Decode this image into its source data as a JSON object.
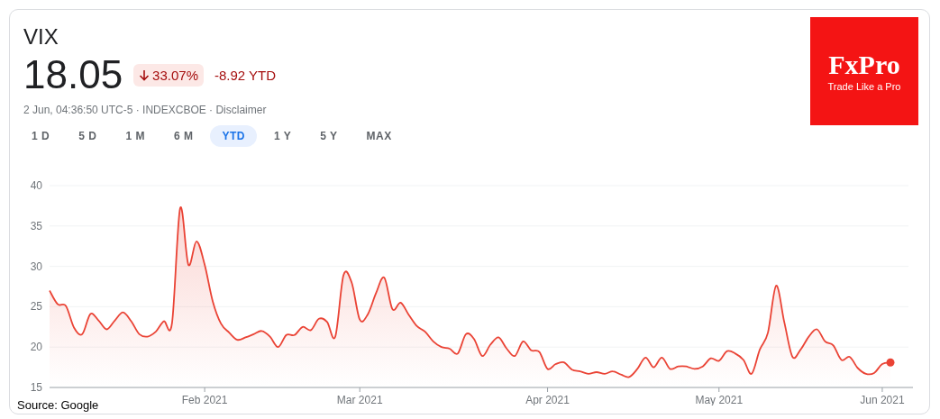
{
  "quote": {
    "ticker": "VIX",
    "price": "18.05",
    "change": {
      "negative": true,
      "text": "33.07%"
    },
    "ytd": "-8.92 YTD",
    "meta": "2 Jun, 04:36:50 UTC-5 · INDEXCBOE · Disclaimer"
  },
  "ranges": [
    {
      "label": "1 D",
      "selected": false
    },
    {
      "label": "5 D",
      "selected": false
    },
    {
      "label": "1 M",
      "selected": false
    },
    {
      "label": "6 M",
      "selected": false
    },
    {
      "label": "YTD",
      "selected": true
    },
    {
      "label": "1 Y",
      "selected": false
    },
    {
      "label": "5 Y",
      "selected": false
    },
    {
      "label": "MAX",
      "selected": false
    }
  ],
  "logo": {
    "name": "FxPro",
    "tagline": "Trade Like a Pro"
  },
  "chart_data": {
    "type": "area",
    "categories": [
      null,
      null,
      null,
      null,
      null,
      null,
      null,
      null,
      null,
      null,
      null,
      null,
      null,
      null,
      null,
      null,
      null,
      null,
      null,
      "Feb 2021",
      null,
      null,
      null,
      null,
      null,
      null,
      null,
      null,
      null,
      null,
      null,
      null,
      null,
      null,
      null,
      null,
      null,
      null,
      "Mar 2021",
      null,
      null,
      null,
      null,
      null,
      null,
      null,
      null,
      null,
      null,
      null,
      null,
      null,
      null,
      null,
      null,
      null,
      null,
      null,
      null,
      null,
      null,
      "Apr 2021",
      null,
      null,
      null,
      null,
      null,
      null,
      null,
      null,
      null,
      null,
      null,
      null,
      null,
      null,
      null,
      null,
      null,
      null,
      null,
      null,
      "May 2021",
      null,
      null,
      null,
      null,
      null,
      null,
      null,
      null,
      null,
      null,
      null,
      null,
      null,
      null,
      null,
      null,
      null,
      null,
      null,
      "Jun 2021",
      null
    ],
    "series": [
      {
        "color": "#ea4335",
        "values": [
          27,
          25.3,
          25.1,
          22.4,
          21.6,
          24.1,
          23.3,
          22.2,
          23.3,
          24.3,
          23.2,
          21.6,
          21.3,
          21.9,
          23.2,
          23,
          37.2,
          30.2,
          33.1,
          30.2,
          25.6,
          22.9,
          21.8,
          20.9,
          21.2,
          21.6,
          22,
          21.3,
          20,
          21.5,
          21.5,
          22.5,
          22.1,
          23.5,
          23.1,
          21.3,
          28.9,
          28,
          23.4,
          24.1,
          26.7,
          28.6,
          24.7,
          25.5,
          24,
          22.6,
          21.9,
          20.7,
          20,
          19.8,
          19.2,
          21.6,
          21,
          18.9,
          20.3,
          21.2,
          19.8,
          18.9,
          20.7,
          19.6,
          19.4,
          17.3,
          17.9,
          18.1,
          17.2,
          17,
          16.7,
          16.9,
          16.7,
          17,
          16.6,
          16.3,
          17.3,
          18.7,
          17.5,
          18.7,
          17.3,
          17.6,
          17.6,
          17.3,
          17.6,
          18.6,
          18.3,
          19.5,
          19.2,
          18.4,
          16.7,
          19.7,
          21.8,
          27.6,
          23.1,
          18.8,
          19.7,
          21.3,
          22.2,
          20.7,
          20.2,
          18.4,
          18.8,
          17.4,
          16.7,
          16.8,
          17.9,
          18.1
        ]
      }
    ],
    "ylim": [
      15,
      40
    ],
    "yticks": [
      15,
      20,
      25,
      30,
      35,
      40
    ],
    "grid": true
  },
  "source": "Source: Google"
}
